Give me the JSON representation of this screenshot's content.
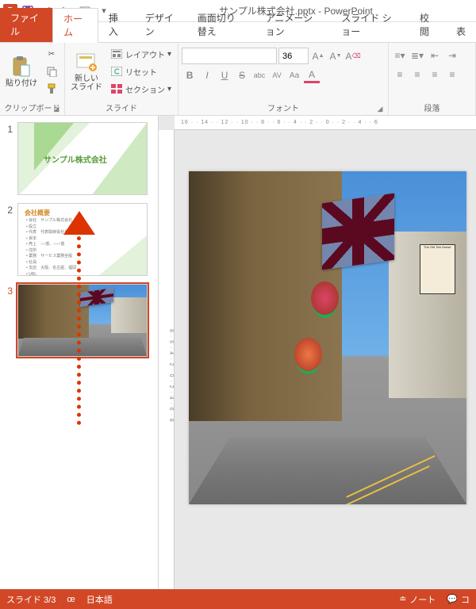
{
  "app": {
    "icon_letter": "P",
    "title": "サンプル株式会社.pptx - PowerPoint"
  },
  "qat": {
    "save": "save",
    "undo": "undo",
    "redo": "redo",
    "start": "start",
    "more": "more"
  },
  "tabs": {
    "file": "ファイル",
    "home": "ホーム",
    "insert": "挿入",
    "design": "デザイン",
    "transitions": "画面切り替え",
    "animations": "アニメーション",
    "slideshow": "スライド ショー",
    "review": "校閲",
    "view": "表"
  },
  "ribbon": {
    "clipboard": {
      "label": "クリップボード",
      "paste": "貼り付け",
      "cut": "cut",
      "copy": "copy",
      "fmt": "format-painter"
    },
    "slides": {
      "label": "スライド",
      "new_slide": "新しい\nスライド",
      "layout": "レイアウト",
      "reset": "リセット",
      "section": "セクション"
    },
    "font": {
      "label": "フォント",
      "name": "",
      "size": "36",
      "bold": "B",
      "italic": "I",
      "underline": "U",
      "strike": "S",
      "shadow": "abc",
      "spacing": "AV",
      "case": "Aa",
      "clear": "A"
    },
    "paragraph": {
      "label": "段落"
    }
  },
  "thumbs": [
    {
      "num": "1",
      "kind": "title",
      "title": "サンプル株式会社"
    },
    {
      "num": "2",
      "kind": "content",
      "header": "会社概要",
      "bullets": "• 会社　サンプル株式会社\n• 設立\n• 代表　代表取締役社長\n• 資本\n• 売上　○○億、○○○億\n• 住所\n• 業務　サービス業務全般\n• 社員\n• 支店　大阪、名古屋、福岡\n• URL"
    },
    {
      "num": "3",
      "kind": "photo",
      "selected": true
    }
  ],
  "main_slide": {
    "sign": "The Old Tea House"
  },
  "ruler": {
    "h": "16 · · 14 · · 12 · · 10 · · 8 · · 6 · · 4 · · 2 · · 0 · · 2 · · 4 · · 6",
    "v": "8 · 6 · 4 · 2 · 0 · 2 · 4 · 6 · 8"
  },
  "status": {
    "slide": "スライド 3/3",
    "lang": "日本語",
    "notes": "ノート",
    "comments": "コ"
  }
}
